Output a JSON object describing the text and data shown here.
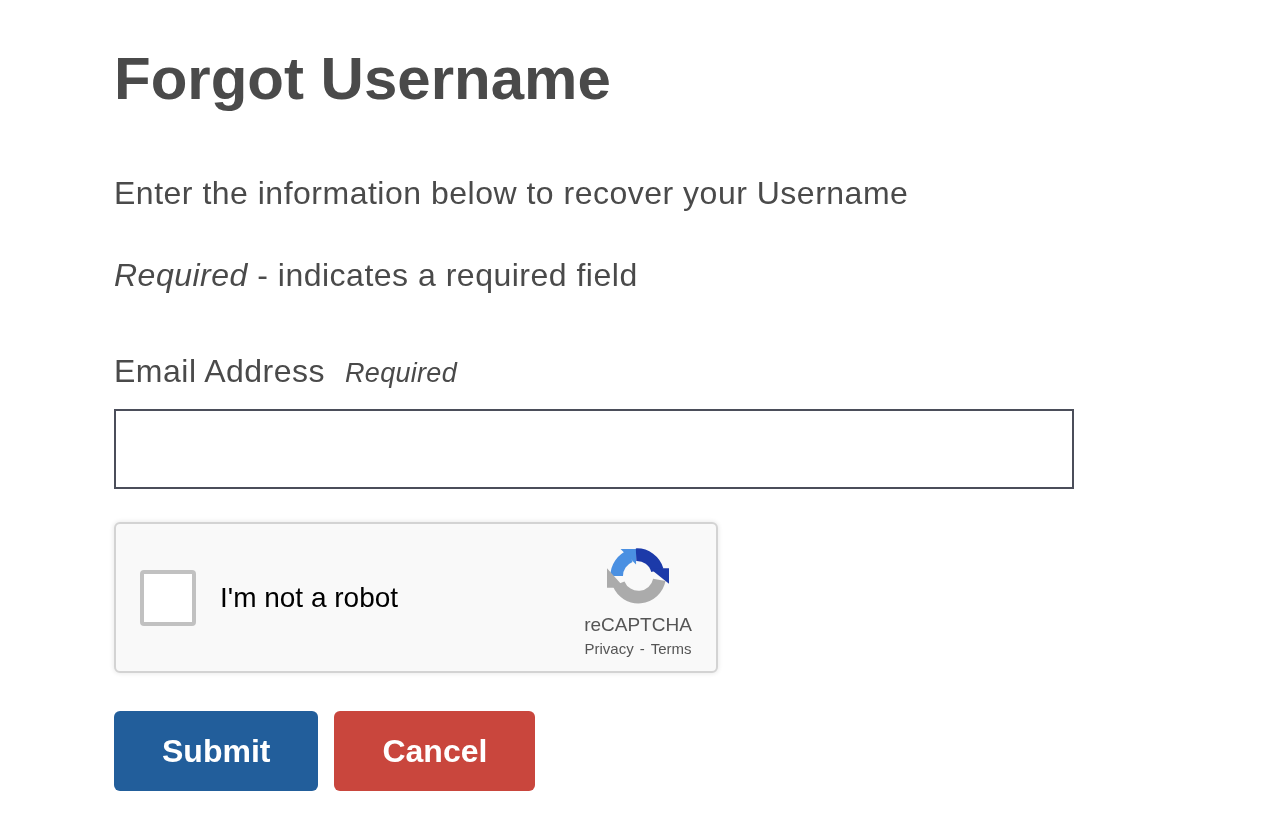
{
  "page": {
    "title": "Forgot Username",
    "intro": "Enter the information below to recover your Username",
    "required_note": "*Required* - indicates a required field"
  },
  "form": {
    "email_field": {
      "label": "Email Address",
      "tag": "Required"
    },
    "captcha": {
      "checked": false,
      "label": "I'm not a robot",
      "brand": "reCAPTCHA",
      "links": [
        "Privacy",
        "Terms"
      ],
      "separator": "-"
    },
    "buttons": [
      {
        "label": "Submit",
        "kind": "primary"
      },
      {
        "label": "Cancel",
        "kind": "danger"
      }
    ]
  }
}
